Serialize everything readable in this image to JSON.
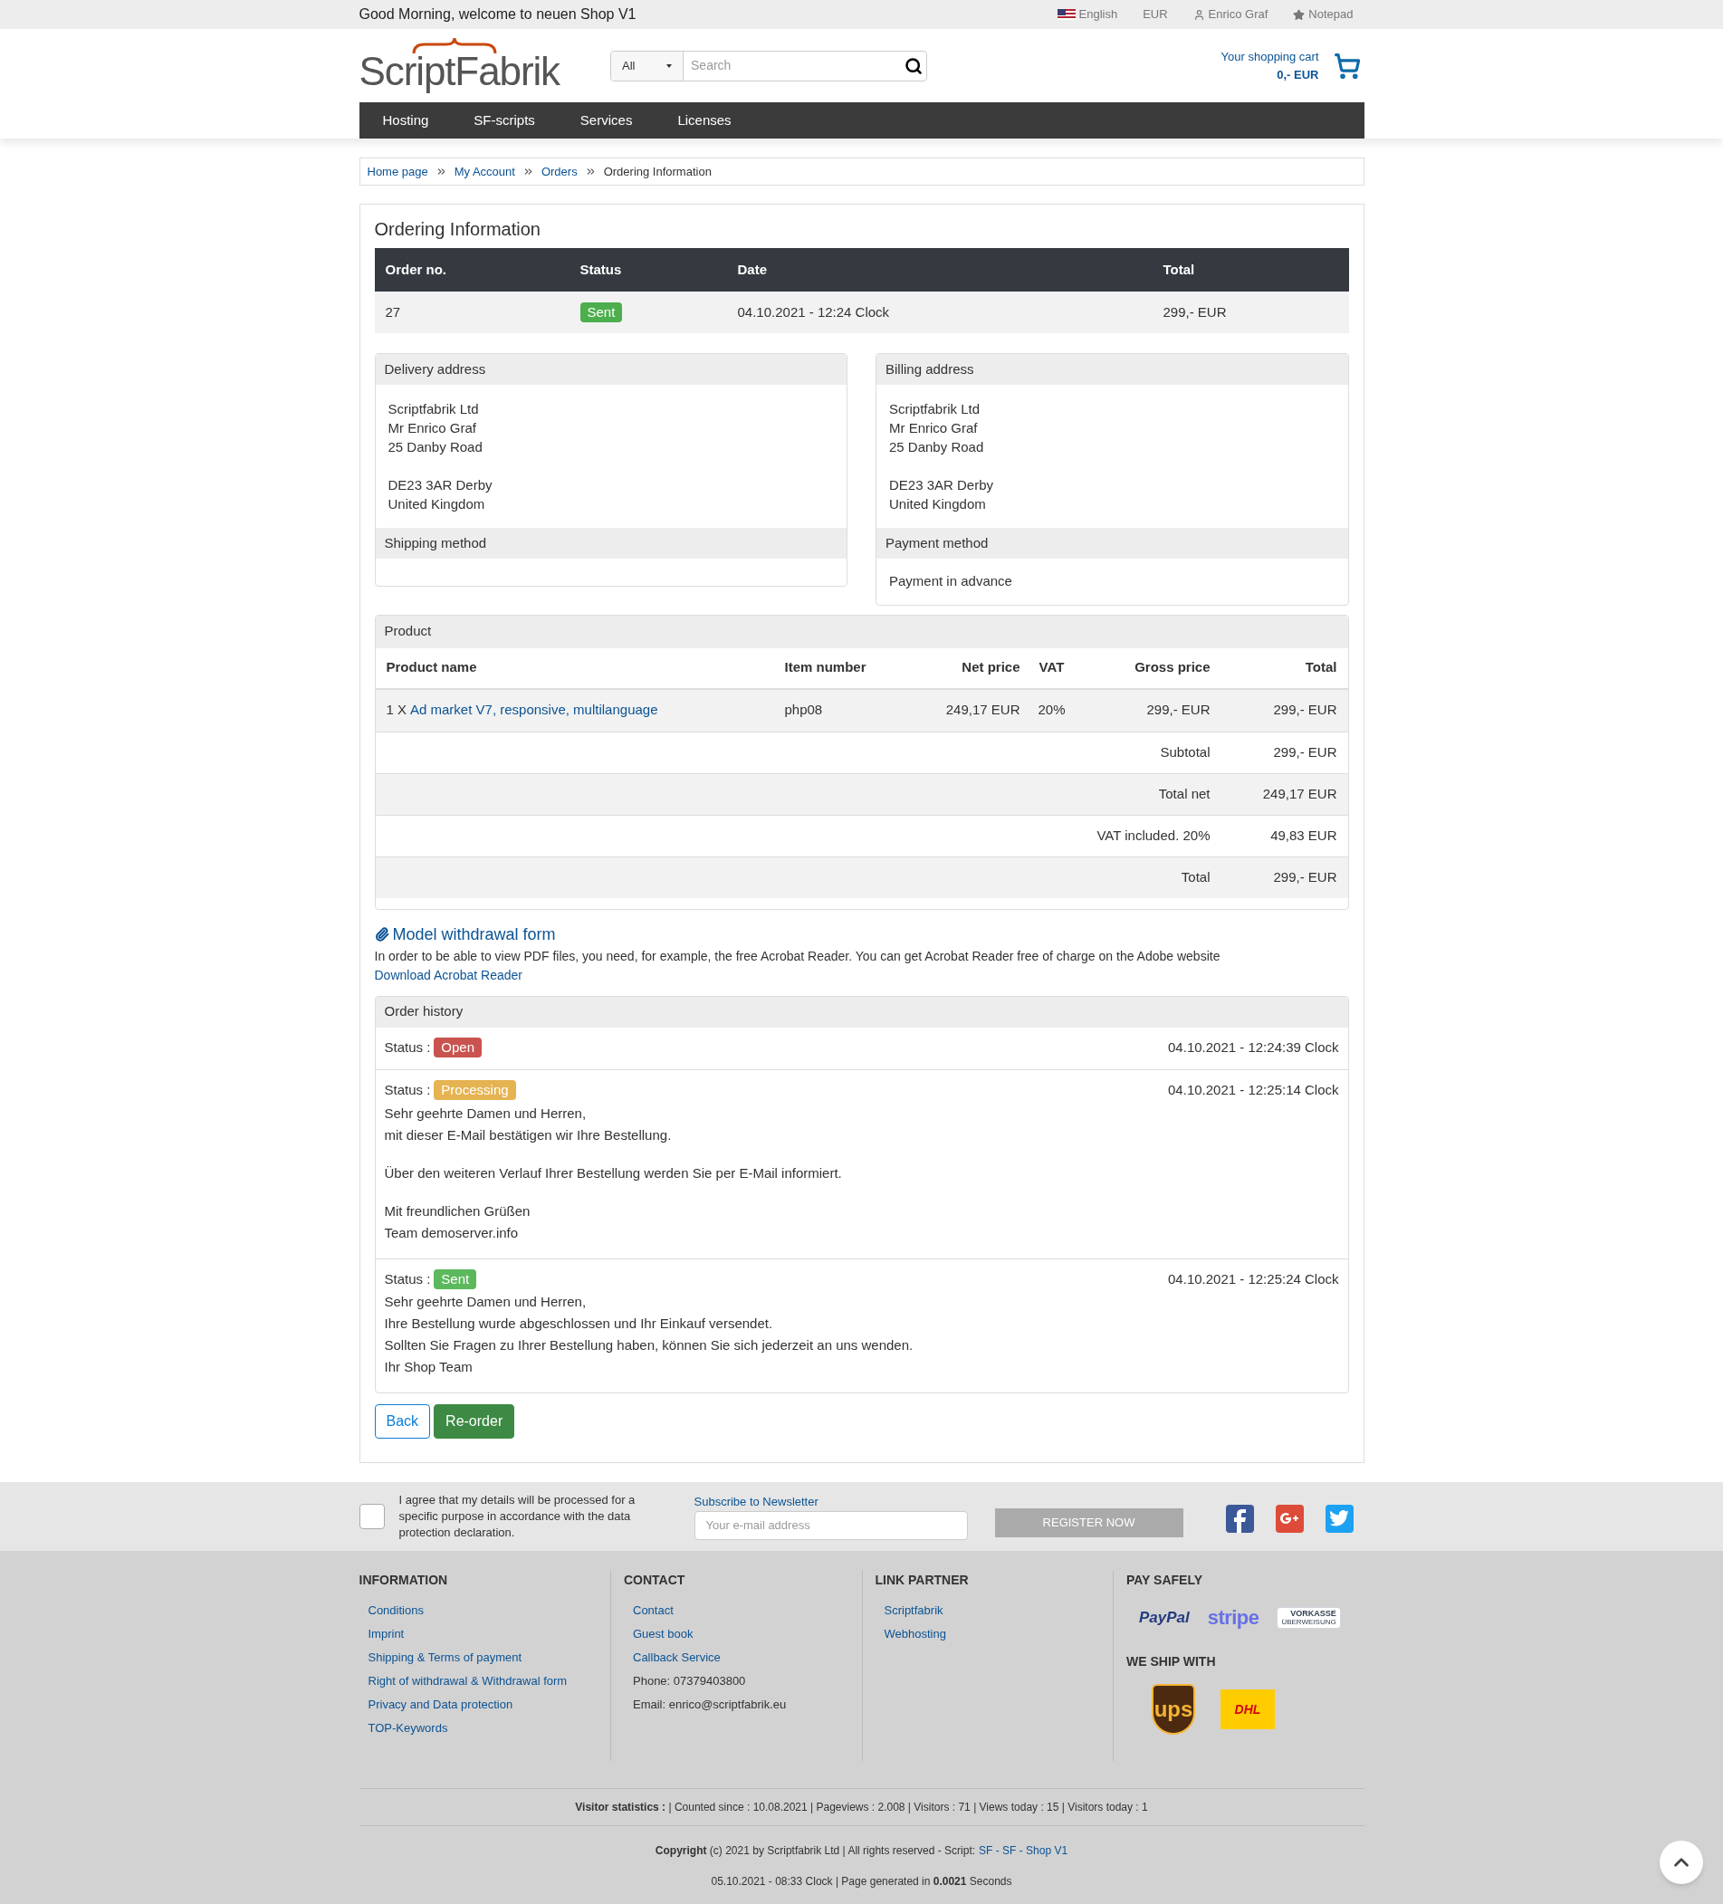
{
  "topbar": {
    "greeting": "Good Morning, welcome to neuen Shop V1",
    "language": "English",
    "currency": "EUR",
    "user": "Enrico Graf",
    "notepad": "Notepad"
  },
  "header": {
    "logo": "ScriptFabrik",
    "search": {
      "category": "All",
      "placeholder": "Search"
    },
    "cart": {
      "label": "Your shopping cart",
      "total": "0,- EUR"
    }
  },
  "nav": [
    "Hosting",
    "SF-scripts",
    "Services",
    "Licenses"
  ],
  "breadcrumb": [
    {
      "label": "Home page",
      "link": true
    },
    {
      "label": "My Account",
      "link": true
    },
    {
      "label": "Orders",
      "link": true
    },
    {
      "label": "Ordering Information",
      "link": false
    }
  ],
  "order": {
    "title": "Ordering Information",
    "columns": [
      "Order no.",
      "Status",
      "Date",
      "Total"
    ],
    "row": {
      "number": "27",
      "status": "Sent",
      "color": "#4cae4c",
      "date": "04.10.2021 - 12:24 Clock",
      "total": "299,- EUR"
    }
  },
  "addresses": [
    {
      "title": "Delivery address",
      "blocks": [
        [
          "Scriptfabrik Ltd",
          "Mr Enrico Graf",
          "25 Danby Road"
        ],
        [
          "DE23 3AR Derby",
          "United Kingdom"
        ]
      ],
      "method_title": "Shipping method"
    },
    {
      "title": "Billing address",
      "blocks": [
        [
          "Scriptfabrik Ltd",
          "Mr Enrico Graf",
          "25 Danby Road"
        ],
        [
          "DE23 3AR Derby",
          "United Kingdom"
        ]
      ],
      "method_title": "Payment method",
      "method": "Payment in advance"
    }
  ],
  "products": {
    "title": "Product",
    "columns": [
      "Product name",
      "Item number",
      "Net price",
      "VAT",
      "Gross price",
      "Total"
    ],
    "rows": [
      {
        "quantity": "1 X",
        "name": "Ad market V7, responsive, multilanguage",
        "item_number": "php08",
        "net": "249,17 EUR",
        "vat": "20%",
        "gross": "299,- EUR",
        "total": "299,- EUR"
      }
    ],
    "summary": [
      {
        "label": "Subtotal",
        "value": "299,- EUR"
      },
      {
        "label": "Total net",
        "value": "249,17 EUR"
      },
      {
        "label": "VAT included. 20%",
        "value": "49,83 EUR"
      },
      {
        "label": "Total",
        "value": "299,- EUR"
      }
    ]
  },
  "withdrawal": {
    "title": "Model withdrawal form",
    "text": "In order to be able to view PDF files, you need, for example, the free Acrobat Reader. You can get Acrobat Reader free of charge on the Adobe website",
    "link": "Download Acrobat Reader"
  },
  "history": {
    "title": "Order history",
    "entries": [
      {
        "status_label": "Status :",
        "status": "Open",
        "color": "#c9534f",
        "time": "04.10.2021 - 12:24:39 Clock"
      },
      {
        "status_label": "Status :",
        "status": "Processing",
        "color": "#e5b351",
        "time": "04.10.2021 - 12:25:14 Clock",
        "message": [
          [
            "Sehr geehrte Damen und Herren,",
            "mit dieser E-Mail bestätigen wir Ihre Bestellung."
          ],
          [
            "Über den weiteren Verlauf Ihrer Bestellung werden Sie per E-Mail informiert."
          ],
          [
            "Mit freundlichen Grüßen",
            "Team demoserver.info"
          ]
        ]
      },
      {
        "status_label": "Status :",
        "status": "Sent",
        "color": "#5cb85c",
        "time": "04.10.2021 - 12:25:24 Clock",
        "message": [
          [
            "Sehr geehrte Damen und Herren,",
            "Ihre Bestellung wurde abgeschlossen und Ihr Einkauf versendet.",
            "Sollten Sie Fragen zu Ihrer Bestellung haben, können Sie sich jederzeit an uns wenden.",
            "Ihr Shop Team"
          ]
        ]
      }
    ]
  },
  "buttons": [
    {
      "label": "Back",
      "kind": "outline"
    },
    {
      "label": "Re-order",
      "kind": "primary"
    }
  ],
  "newsletter": {
    "consent": "I agree that my details will be processed for a specific purpose in accordance with the data protection declaration.",
    "checked": false,
    "title": "Subscribe to Newsletter",
    "placeholder": "Your e-mail address",
    "button": "REGISTER NOW"
  },
  "footer": {
    "columns": [
      {
        "title": "INFORMATION",
        "links": [
          "Conditions",
          "Imprint",
          "Shipping & Terms of payment",
          "Right of withdrawal & Withdrawal form",
          "Privacy and Data protection",
          "TOP-Keywords"
        ]
      },
      {
        "title": "CONTACT",
        "links": [
          "Contact",
          "Guest book",
          "Callback Service"
        ],
        "lines": [
          "Phone: 07379403800",
          "Email: enrico@scriptfabrik.eu"
        ]
      },
      {
        "title": "LINK PARTNER",
        "links": [
          "Scriptfabrik",
          "Webhosting"
        ]
      }
    ],
    "pay_title": "PAY SAFELY",
    "pay_logos": [
      {
        "kind": "paypal",
        "text": "PayPal"
      },
      {
        "kind": "stripe",
        "text": "stripe"
      },
      {
        "kind": "vorkasse",
        "text": "VORKASSE",
        "subtext": "ÜBERWEISUNG"
      }
    ],
    "ship_title": "WE SHIP WITH",
    "ship_logos": [
      {
        "kind": "ups",
        "text": "ups"
      },
      {
        "kind": "dhl",
        "text": "DHL"
      }
    ],
    "stats": "**Visitor statistics :** | Counted since : 10.08.2021 | Pageviews : 2.008 | Visitors : 71 | Views today : 15 | Visitors today : 1",
    "copyright": "**Copyright** (c) 2021 by Scriptfabrik Ltd | All rights reserved - Script:",
    "script_link": "SF - SF - Shop V1",
    "generated": "05.10.2021 - 08:33 Clock | Page generated in **0.0021** Seconds"
  }
}
